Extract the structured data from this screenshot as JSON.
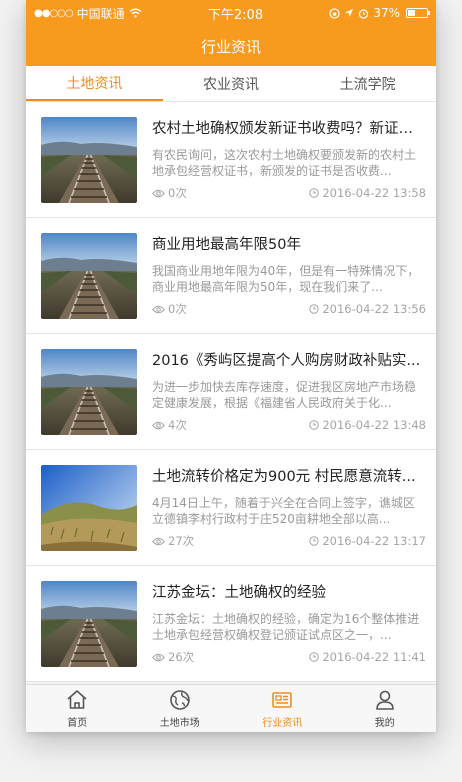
{
  "status": {
    "signal_dots": "●●○○○",
    "carrier": "中国联通",
    "time": "下午2:08",
    "battery": "37%",
    "battery_level": 0.37
  },
  "header": {
    "title": "行业资讯"
  },
  "tabs": [
    {
      "label": "土地资讯",
      "active": true
    },
    {
      "label": "农业资讯",
      "active": false
    },
    {
      "label": "土流学院",
      "active": false
    }
  ],
  "articles": [
    {
      "title": "农村土地确权颁发新证书收费吗？新证书...",
      "desc": "有农民询问，这次农村土地确权要颁发新的农村土地承包经营权证书，新颁发的证书是否收费...",
      "views": "0次",
      "date": "2016-04-22 13:58",
      "thumb": "railroad-icon"
    },
    {
      "title": "商业用地最高年限50年",
      "desc": "我国商业用地年限为40年，但是有一特殊情况下，商业用地最高年限为50年，现在我们来了...",
      "views": "0次",
      "date": "2016-04-22 13:56",
      "thumb": "railroad-icon"
    },
    {
      "title": "2016《秀屿区提高个人购房财政补贴实...",
      "desc": "为进一步加快去库存速度，促进我区房地产市场稳定健康发展，根据《福建省人民政府关于化...",
      "views": "4次",
      "date": "2016-04-22 13:48",
      "thumb": "railroad-icon"
    },
    {
      "title": "土地流转价格定为900元 村民愿意流转...",
      "desc": "4月14日上午，随着于兴全在合同上签字，谯城区立德镇李村行政村于庄520亩耕地全部以高...",
      "views": "27次",
      "date": "2016-04-22 13:17",
      "thumb": "field-icon"
    },
    {
      "title": "江苏金坛：土地确权的经验",
      "desc": "江苏金坛：土地确权的经验，确定为16个整体推进土地承包经营权确权登记颁证试点区之一，...",
      "views": "26次",
      "date": "2016-04-22 11:41",
      "thumb": "railroad-icon"
    }
  ],
  "bottom_nav": [
    {
      "label": "首页",
      "icon": "home-icon",
      "active": false
    },
    {
      "label": "土地市场",
      "icon": "globe-icon",
      "active": false
    },
    {
      "label": "行业资讯",
      "icon": "news-icon",
      "active": true
    },
    {
      "label": "我的",
      "icon": "user-icon",
      "active": false
    }
  ],
  "colors": {
    "accent": "#f79a1e",
    "active_text": "#f08c1c"
  }
}
